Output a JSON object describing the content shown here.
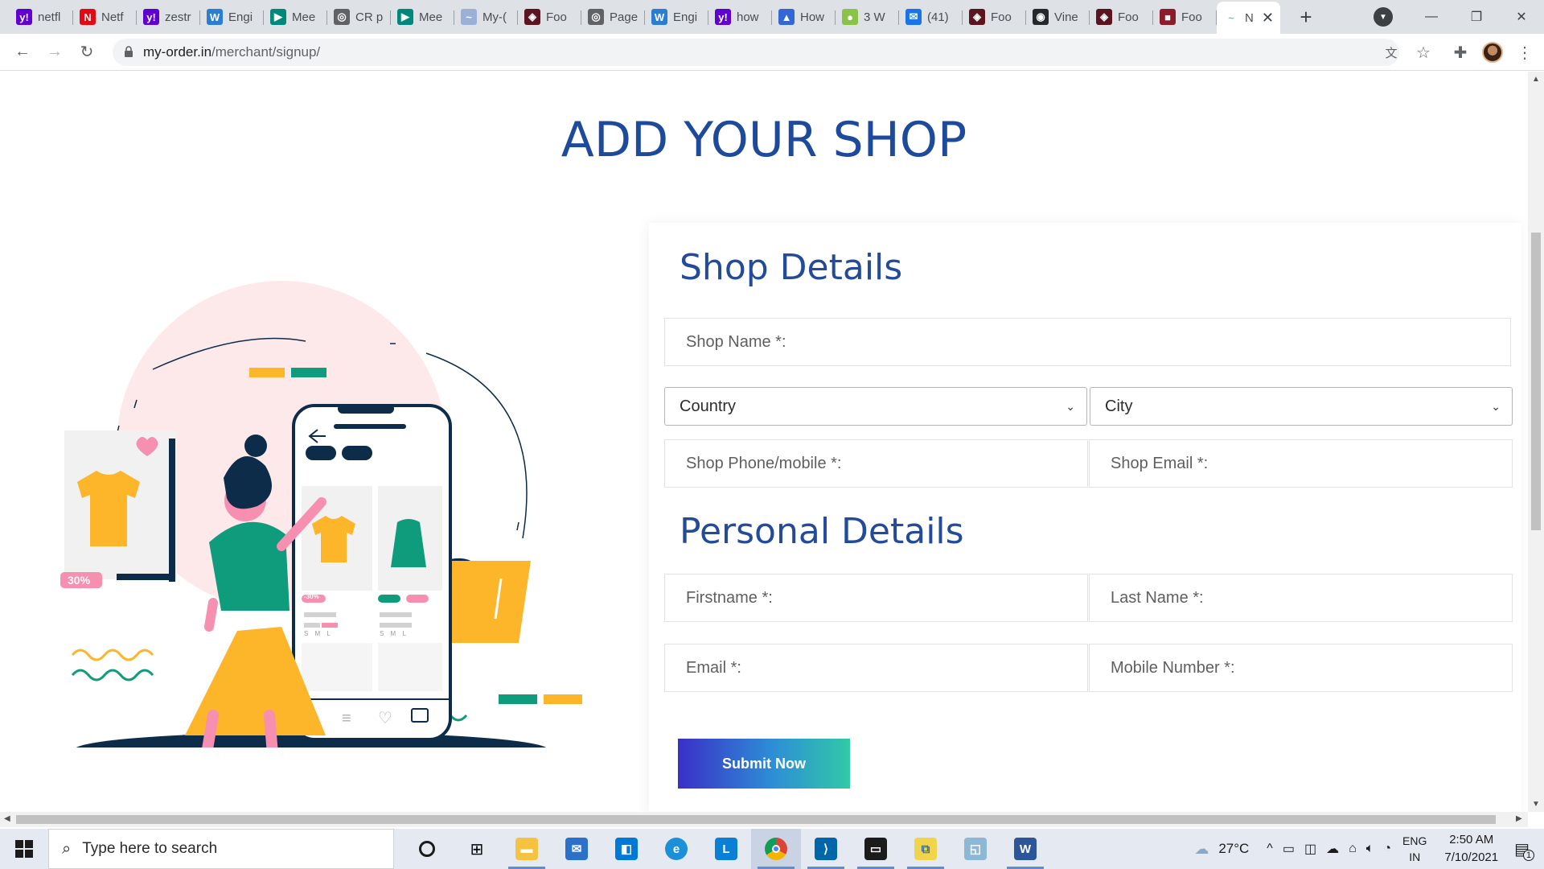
{
  "browser": {
    "tabs": [
      {
        "title": "netfl",
        "icon": "yahoo-icon",
        "color": "#5f01d1",
        "glyph": "y!"
      },
      {
        "title": "Netf",
        "icon": "netflix-icon",
        "color": "#e50914",
        "glyph": "N"
      },
      {
        "title": "zestr",
        "icon": "yahoo-icon",
        "color": "#5f01d1",
        "glyph": "y!"
      },
      {
        "title": "Engi",
        "icon": "word-icon",
        "color": "#2b7cd3",
        "glyph": "W"
      },
      {
        "title": "Mee",
        "icon": "meet-icon",
        "color": "#00897b",
        "glyph": "▶"
      },
      {
        "title": "CR p",
        "icon": "globe-icon",
        "color": "#5f6368",
        "glyph": "◎"
      },
      {
        "title": "Mee",
        "icon": "meet-icon",
        "color": "#00897b",
        "glyph": "▶"
      },
      {
        "title": "My-(",
        "icon": "myorder-icon",
        "color": "#9bb0d6",
        "glyph": "~"
      },
      {
        "title": "Foo",
        "icon": "shield-icon",
        "color": "#5b1420",
        "glyph": "◈"
      },
      {
        "title": "Page",
        "icon": "globe-icon",
        "color": "#5f6368",
        "glyph": "◎"
      },
      {
        "title": "Engi",
        "icon": "word-icon",
        "color": "#2b7cd3",
        "glyph": "W"
      },
      {
        "title": "how",
        "icon": "yahoo-icon",
        "color": "#5f01d1",
        "glyph": "y!"
      },
      {
        "title": "How",
        "icon": "bookmark-icon",
        "color": "#3367d6",
        "glyph": "▲"
      },
      {
        "title": "3 W",
        "icon": "app-icon",
        "color": "#8bc34a",
        "glyph": "●"
      },
      {
        "title": "(41)",
        "icon": "mail-icon",
        "color": "#1a73e8",
        "glyph": "✉"
      },
      {
        "title": "Foo",
        "icon": "shield-icon",
        "color": "#5b1420",
        "glyph": "◈"
      },
      {
        "title": "Vine",
        "icon": "github-icon",
        "color": "#24292e",
        "glyph": "◉"
      },
      {
        "title": "Foo",
        "icon": "shield-icon",
        "color": "#5b1420",
        "glyph": "◈"
      },
      {
        "title": "Foo",
        "icon": "food-icon",
        "color": "#8e1b2b",
        "glyph": "■"
      }
    ],
    "active_tab": {
      "title": "N",
      "icon": "myorder-icon"
    },
    "url_host": "my-order.in",
    "url_path": "/merchant/signup/"
  },
  "page": {
    "title": "ADD YOUR SHOP",
    "shop_section_title": "Shop Details",
    "personal_section_title": "Personal Details",
    "fields": {
      "shop_name": "Shop Name *:",
      "country": "Country",
      "city": "City",
      "shop_phone": "Shop Phone/mobile *:",
      "shop_email": "Shop Email *:",
      "firstname": "Firstname *:",
      "lastname": "Last Name *:",
      "email": "Email *:",
      "mobile": "Mobile Number *:"
    },
    "submit_label": "Submit Now",
    "illustration": {
      "discount_badge": "30%",
      "phone_badge": "-30%",
      "sizes": "S M L"
    }
  },
  "taskbar": {
    "search_placeholder": "Type here to search",
    "weather": "27°C",
    "lang_top": "ENG",
    "lang_bottom": "IN",
    "time": "2:50 AM",
    "date": "7/10/2021",
    "notification_count": "1"
  },
  "colors": {
    "title_blue": "#1e4a9c",
    "section_blue": "#234b9a",
    "illus_yellow": "#fdb52a",
    "illus_green": "#0f9c7c",
    "illus_pink": "#f68fb0",
    "illus_navy": "#0c2c4a"
  }
}
